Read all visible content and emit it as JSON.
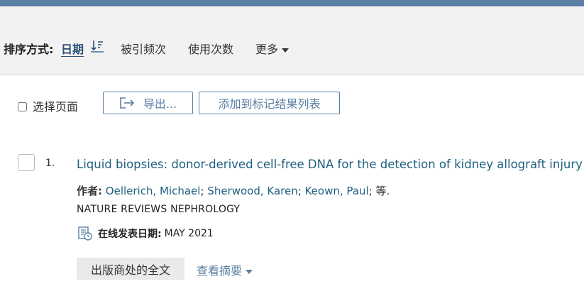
{
  "sort": {
    "label": "排序方式:",
    "active": "日期",
    "options": [
      "被引频次",
      "使用次数"
    ],
    "more": "更多"
  },
  "toolbar": {
    "select_page": "选择页面",
    "export": "导出...",
    "add_to_marked": "添加到标记结果列表"
  },
  "result": {
    "number": "1.",
    "title": "Liquid biopsies: donor-derived cell-free DNA for the detection of kidney allograft injury",
    "authors_label": "作者:",
    "authors": [
      "Oellerich, Michael",
      "Sherwood, Karen",
      "Keown, Paul"
    ],
    "authors_etc": "等.",
    "journal": "NATURE REVIEWS NEPHROLOGY",
    "pub_label": "在线发表日期:",
    "pub_date": "MAY 2021",
    "fulltext": "出版商处的全文",
    "abstract": "查看摘要"
  },
  "colors": {
    "link": "#1f5f80",
    "accent": "#5a7fa3",
    "topbar": "#5a7fa3"
  },
  "icons": [
    "sort-descending-icon",
    "export-icon",
    "calendar-icon",
    "chevron-down-icon"
  ]
}
